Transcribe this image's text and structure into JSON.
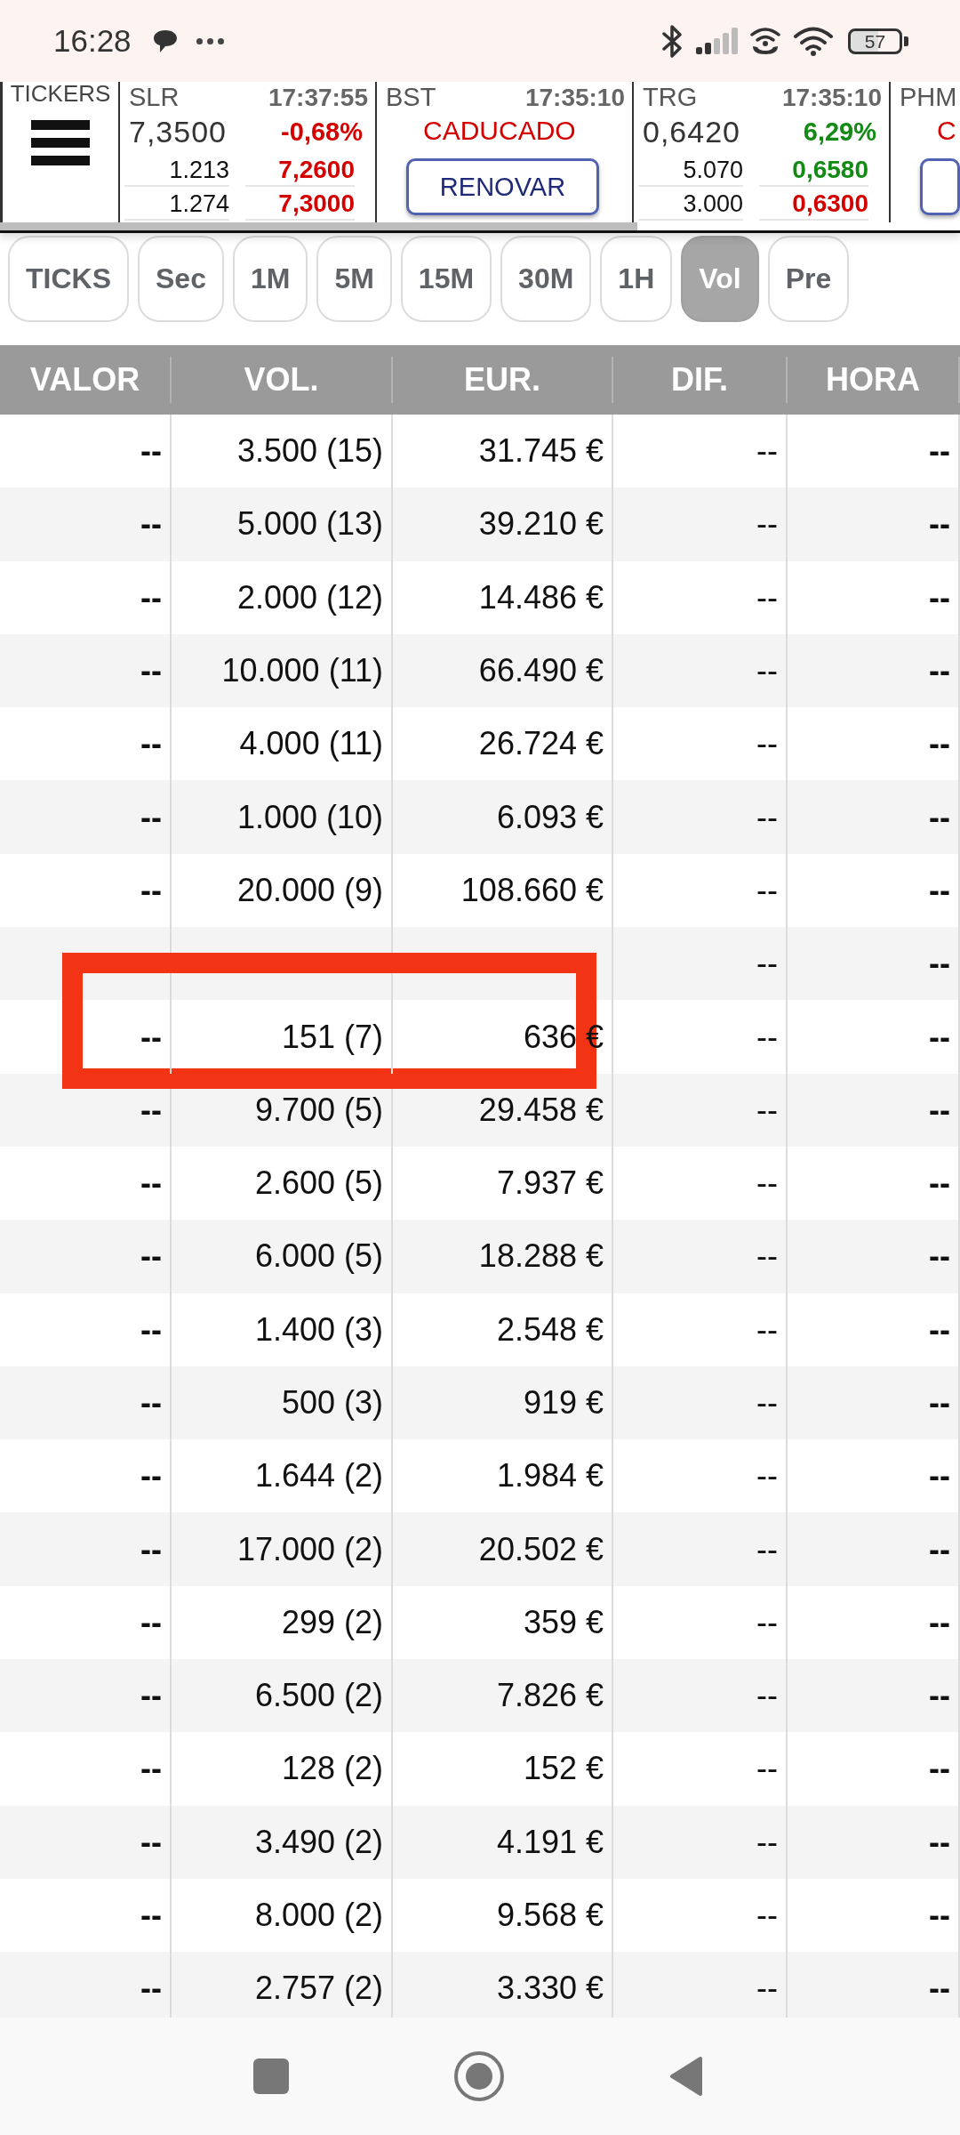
{
  "status_bar": {
    "time": "16:28",
    "battery": "57"
  },
  "tickers": {
    "label": "TICKERS",
    "cards": [
      {
        "kind": "quote",
        "symbol": "SLR",
        "time": "17:37:55",
        "price": "7,3500",
        "change": {
          "text": "-0,68%",
          "color": "#d40000"
        },
        "book": [
          {
            "qty": "1.213",
            "price": "7,2600",
            "color": "#d40000"
          },
          {
            "qty": "1.274",
            "price": "7,3000",
            "color": "#d40000"
          }
        ]
      },
      {
        "kind": "expired",
        "symbol": "BST",
        "time": "17:35:10",
        "status": "CADUCADO",
        "button": "RENOVAR"
      },
      {
        "kind": "quote",
        "symbol": "TRG",
        "time": "17:35:10",
        "price": "0,6420",
        "change": {
          "text": "6,29%",
          "color": "#138a13"
        },
        "book": [
          {
            "qty": "5.070",
            "price": "0,6580",
            "color": "#138a13"
          },
          {
            "qty": "3.000",
            "price": "0,6300",
            "color": "#d40000"
          }
        ]
      },
      {
        "kind": "expired",
        "symbol": "PHM",
        "status": "C"
      }
    ]
  },
  "timeframes": [
    {
      "label": "TICKS",
      "selected": false
    },
    {
      "label": "Sec",
      "selected": false
    },
    {
      "label": "1M",
      "selected": false
    },
    {
      "label": "5M",
      "selected": false
    },
    {
      "label": "15M",
      "selected": false
    },
    {
      "label": "30M",
      "selected": false
    },
    {
      "label": "1H",
      "selected": false
    },
    {
      "label": "Vol",
      "selected": true
    },
    {
      "label": "Pre",
      "selected": false
    }
  ],
  "table": {
    "columns": [
      "VALOR",
      "VOL.",
      "EUR.",
      "DIF.",
      "HORA"
    ],
    "rows": [
      {
        "valor": "--",
        "vol": "3.500 (15)",
        "eur": "31.745 €",
        "dif": "--",
        "hora": "--",
        "highlighted": false
      },
      {
        "valor": "--",
        "vol": "5.000 (13)",
        "eur": "39.210 €",
        "dif": "--",
        "hora": "--",
        "highlighted": false
      },
      {
        "valor": "--",
        "vol": "2.000 (12)",
        "eur": "14.486 €",
        "dif": "--",
        "hora": "--",
        "highlighted": false
      },
      {
        "valor": "--",
        "vol": "10.000 (11)",
        "eur": "66.490 €",
        "dif": "--",
        "hora": "--",
        "highlighted": false
      },
      {
        "valor": "--",
        "vol": "4.000 (11)",
        "eur": "26.724 €",
        "dif": "--",
        "hora": "--",
        "highlighted": false
      },
      {
        "valor": "--",
        "vol": "1.000 (10)",
        "eur": "6.093 €",
        "dif": "--",
        "hora": "--",
        "highlighted": false
      },
      {
        "valor": "--",
        "vol": "20.000 (9)",
        "eur": "108.660 €",
        "dif": "--",
        "hora": "--",
        "highlighted": false
      },
      {
        "dif": "--",
        "hora": "--",
        "highlighted": false
      },
      {
        "valor": "--",
        "vol": "151 (7)",
        "eur": "636 €",
        "dif": "--",
        "hora": "--",
        "highlighted": true
      },
      {
        "valor": "--",
        "vol": "9.700 (5)",
        "eur": "29.458 €",
        "dif": "--",
        "hora": "--",
        "highlighted": false
      },
      {
        "valor": "--",
        "vol": "2.600 (5)",
        "eur": "7.937 €",
        "dif": "--",
        "hora": "--",
        "highlighted": false
      },
      {
        "valor": "--",
        "vol": "6.000 (5)",
        "eur": "18.288 €",
        "dif": "--",
        "hora": "--",
        "highlighted": false
      },
      {
        "valor": "--",
        "vol": "1.400 (3)",
        "eur": "2.548 €",
        "dif": "--",
        "hora": "--",
        "highlighted": false
      },
      {
        "valor": "--",
        "vol": "500 (3)",
        "eur": "919 €",
        "dif": "--",
        "hora": "--",
        "highlighted": false
      },
      {
        "valor": "--",
        "vol": "1.644 (2)",
        "eur": "1.984 €",
        "dif": "--",
        "hora": "--",
        "highlighted": false
      },
      {
        "valor": "--",
        "vol": "17.000 (2)",
        "eur": "20.502 €",
        "dif": "--",
        "hora": "--",
        "highlighted": false
      },
      {
        "valor": "--",
        "vol": "299 (2)",
        "eur": "359 €",
        "dif": "--",
        "hora": "--",
        "highlighted": false
      },
      {
        "valor": "--",
        "vol": "6.500 (2)",
        "eur": "7.826 €",
        "dif": "--",
        "hora": "--",
        "highlighted": false
      },
      {
        "valor": "--",
        "vol": "128 (2)",
        "eur": "152 €",
        "dif": "--",
        "hora": "--",
        "highlighted": false
      },
      {
        "valor": "--",
        "vol": "3.490 (2)",
        "eur": "4.191 €",
        "dif": "--",
        "hora": "--",
        "highlighted": false
      },
      {
        "valor": "--",
        "vol": "8.000 (2)",
        "eur": "9.568 €",
        "dif": "--",
        "hora": "--",
        "highlighted": false
      },
      {
        "valor": "--",
        "vol": "2.757 (2)",
        "eur": "3.330 €",
        "dif": "--",
        "hora": "--",
        "highlighted": false
      }
    ]
  }
}
